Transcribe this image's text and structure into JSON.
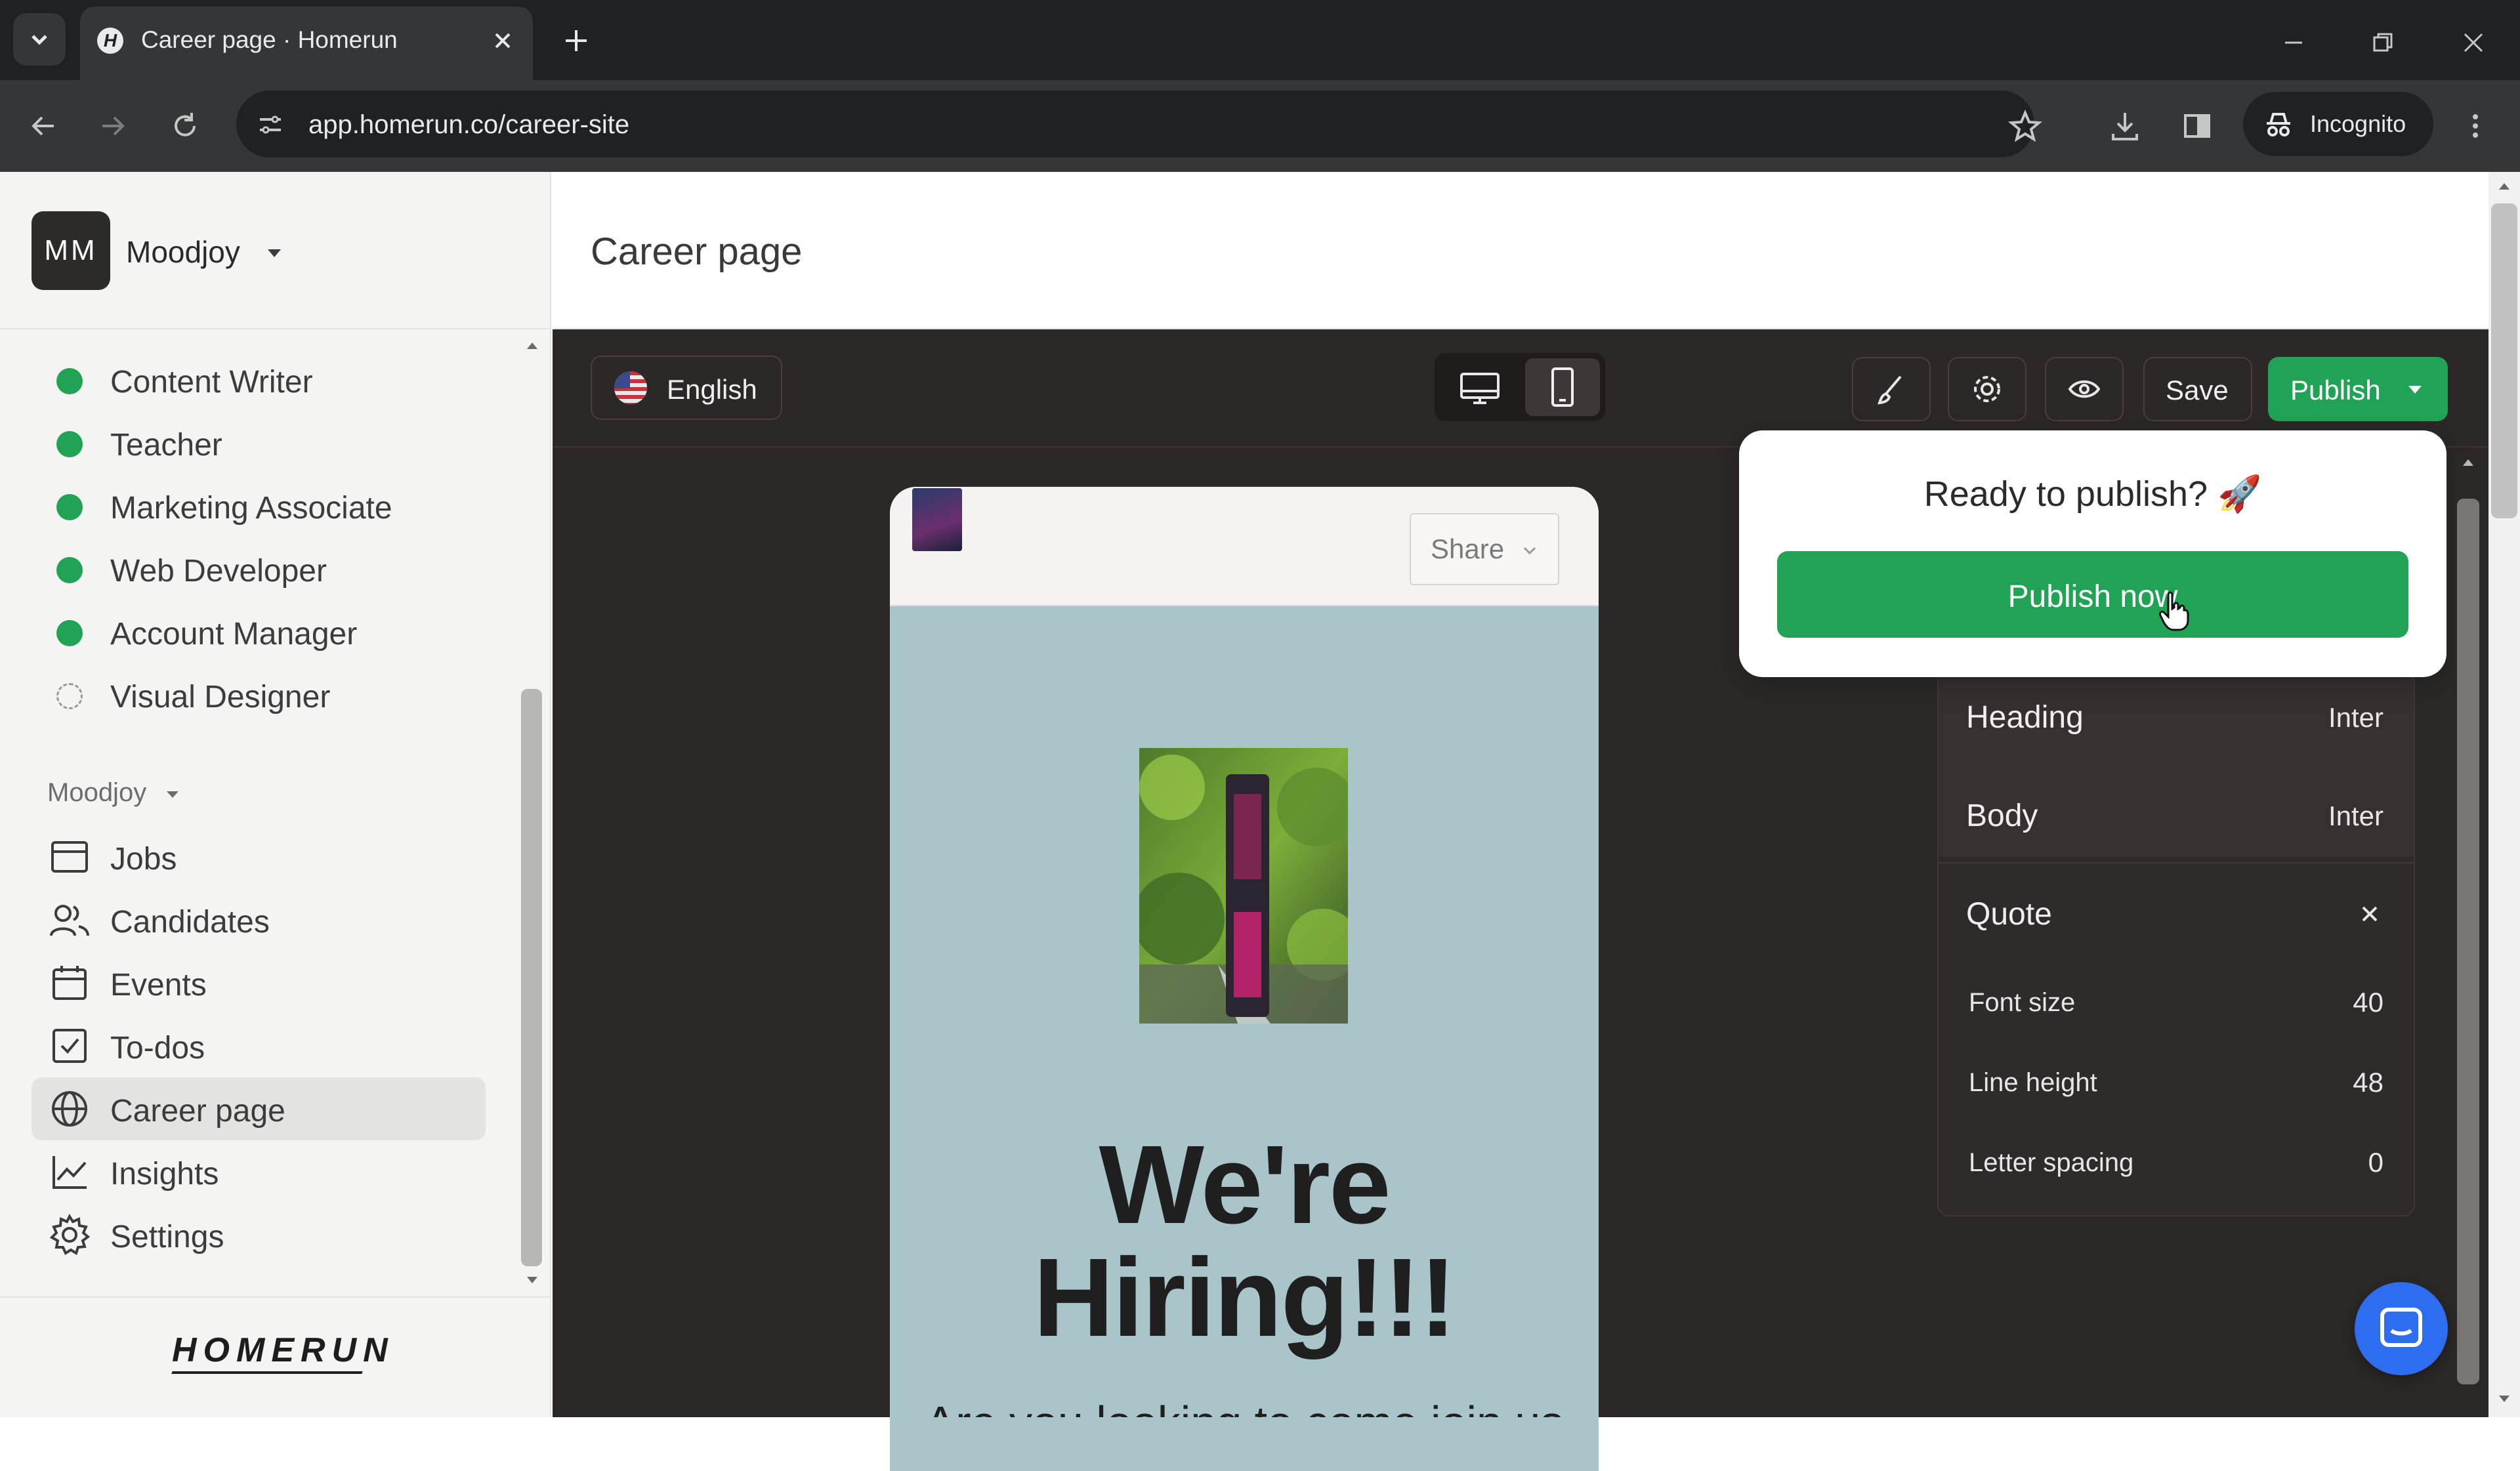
{
  "browser": {
    "tab_title": "Career page · Homerun",
    "url": "app.homerun.co/career-site",
    "incognito_label": "Incognito"
  },
  "sidebar": {
    "avatar_initials": "MM",
    "org_name": "Moodjoy",
    "jobs": [
      {
        "label": "Content Writer",
        "status": "published"
      },
      {
        "label": "Teacher",
        "status": "published"
      },
      {
        "label": "Marketing Associate",
        "status": "published"
      },
      {
        "label": "Web Developer",
        "status": "published"
      },
      {
        "label": "Account Manager",
        "status": "published"
      },
      {
        "label": "Visual Designer",
        "status": "draft"
      }
    ],
    "section_label": "Moodjoy",
    "nav": [
      {
        "label": "Jobs",
        "icon": "jobs-icon"
      },
      {
        "label": "Candidates",
        "icon": "candidates-icon"
      },
      {
        "label": "Events",
        "icon": "calendar-icon"
      },
      {
        "label": "To-dos",
        "icon": "checkbox-icon"
      },
      {
        "label": "Career page",
        "icon": "globe-icon",
        "active": true
      },
      {
        "label": "Insights",
        "icon": "chart-icon"
      },
      {
        "label": "Settings",
        "icon": "gear-icon"
      }
    ],
    "logo_text": "HOMERUN"
  },
  "main": {
    "page_title": "Career page",
    "toolbar": {
      "language": "English",
      "save_label": "Save",
      "publish_label": "Publish"
    },
    "preview": {
      "share_label": "Share",
      "hero_title_line1": "We're",
      "hero_title_line2": "Hiring!!!",
      "hero_subtitle": "Are you looking to come join us"
    },
    "popover": {
      "title": "Ready to publish? 🚀",
      "button": "Publish now"
    },
    "typography": {
      "heading_label": "Heading",
      "heading_font": "Inter",
      "body_label": "Body",
      "body_font": "Inter",
      "quote_label": "Quote",
      "font_size_label": "Font size",
      "font_size_value": "40",
      "line_height_label": "Line height",
      "line_height_value": "48",
      "letter_spacing_label": "Letter spacing",
      "letter_spacing_value": "0"
    }
  },
  "colors": {
    "brand_green": "#21a355",
    "canvas_dark": "#2c2827",
    "chat_blue": "#2f6df0"
  }
}
